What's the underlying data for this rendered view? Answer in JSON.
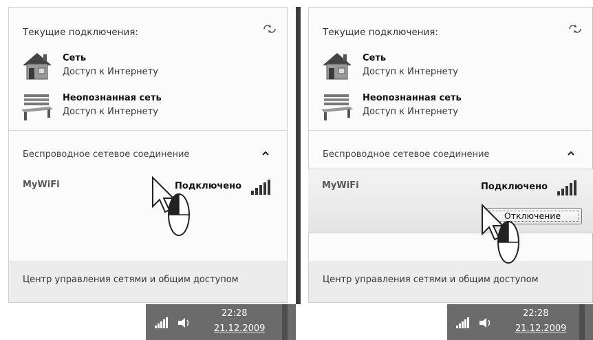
{
  "panels": [
    {
      "heading": "Текущие подключения:",
      "connections": [
        {
          "name": "Сеть",
          "status": "Доступ к Интернету",
          "icon": "home-network-icon"
        },
        {
          "name": "Неопознанная сеть",
          "status": "Доступ к Интернету",
          "icon": "public-network-icon"
        }
      ],
      "section_label": "Беспроводное сетевое соединение",
      "wifi": {
        "name": "MyWiFi",
        "status": "Подключено"
      },
      "footer_link": "Центр управления сетями и общим доступом",
      "clock": {
        "time": "22:28",
        "date": "21.12.2009"
      }
    },
    {
      "heading": "Текущие подключения:",
      "connections": [
        {
          "name": "Сеть",
          "status": "Доступ к Интернету",
          "icon": "home-network-icon"
        },
        {
          "name": "Неопознанная сеть",
          "status": "Доступ к Интернету",
          "icon": "public-network-icon"
        }
      ],
      "section_label": "Беспроводное сетевое соединение",
      "wifi": {
        "name": "MyWiFi",
        "status": "Подключено",
        "disconnect_label": "Отключение"
      },
      "footer_link": "Центр управления сетями и общим доступом",
      "clock": {
        "time": "22:28",
        "date": "21.12.2009"
      }
    }
  ],
  "colors": {
    "taskbar": "#6b6b6b",
    "footer": "#ececec",
    "flyout": "#fbfbfb"
  }
}
